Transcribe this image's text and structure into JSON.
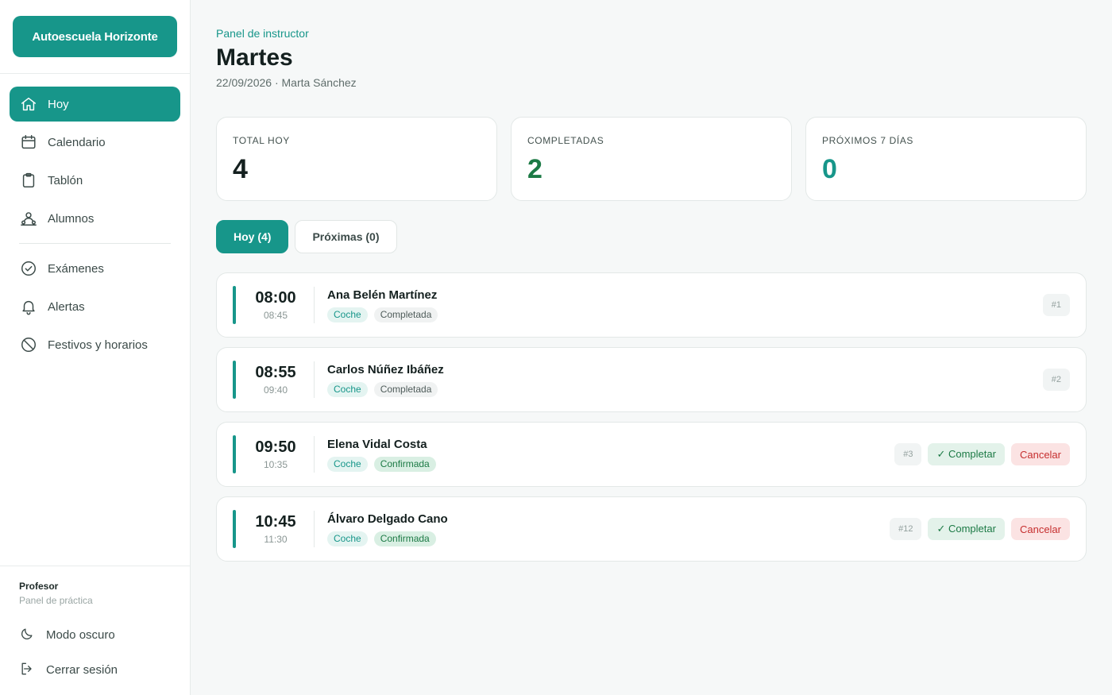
{
  "brand": "Autoescuela Horizonte",
  "nav": [
    {
      "label": "Hoy",
      "icon": "home-icon",
      "active": true
    },
    {
      "label": "Calendario",
      "icon": "calendar-icon"
    },
    {
      "label": "Tablón",
      "icon": "clipboard-icon"
    },
    {
      "label": "Alumnos",
      "icon": "users-icon"
    },
    {
      "label": "Exámenes",
      "icon": "check-circle-icon"
    },
    {
      "label": "Alertas",
      "icon": "bell-icon"
    },
    {
      "label": "Festivos y horarios",
      "icon": "ban-icon"
    }
  ],
  "footer": {
    "role": "Profesor",
    "role_sub": "Panel de práctica",
    "dark_mode": "Modo oscuro",
    "logout": "Cerrar sesión"
  },
  "header": {
    "eyebrow": "Panel de instructor",
    "title": "Martes",
    "subline": "22/09/2026 · Marta Sánchez"
  },
  "stats": [
    {
      "label": "TOTAL HOY",
      "value": "4",
      "color": "#14201f"
    },
    {
      "label": "COMPLETADAS",
      "value": "2",
      "color": "#1c7a45"
    },
    {
      "label": "PRÓXIMOS 7 DÍAS",
      "value": "0",
      "color": "#17968a"
    }
  ],
  "tabs": [
    {
      "label": "Hoy (4)",
      "active": true
    },
    {
      "label": "Próximas (0)",
      "active": false
    }
  ],
  "lessons": [
    {
      "start": "08:00",
      "end": "08:45",
      "student": "Ana Belén Martínez",
      "vehicle": "Coche",
      "status": "Completada",
      "status_kind": "done",
      "number": "#1",
      "actions": false
    },
    {
      "start": "08:55",
      "end": "09:40",
      "student": "Carlos Núñez Ibáñez",
      "vehicle": "Coche",
      "status": "Completada",
      "status_kind": "done",
      "number": "#2",
      "actions": false
    },
    {
      "start": "09:50",
      "end": "10:35",
      "student": "Elena Vidal Costa",
      "vehicle": "Coche",
      "status": "Confirmada",
      "status_kind": "confirmed",
      "number": "#3",
      "actions": true
    },
    {
      "start": "10:45",
      "end": "11:30",
      "student": "Álvaro Delgado Cano",
      "vehicle": "Coche",
      "status": "Confirmada",
      "status_kind": "confirmed",
      "number": "#12",
      "actions": true
    }
  ],
  "actions": {
    "complete": "✓ Completar",
    "cancel": "Cancelar"
  },
  "colors": {
    "accent": "#17968a"
  }
}
